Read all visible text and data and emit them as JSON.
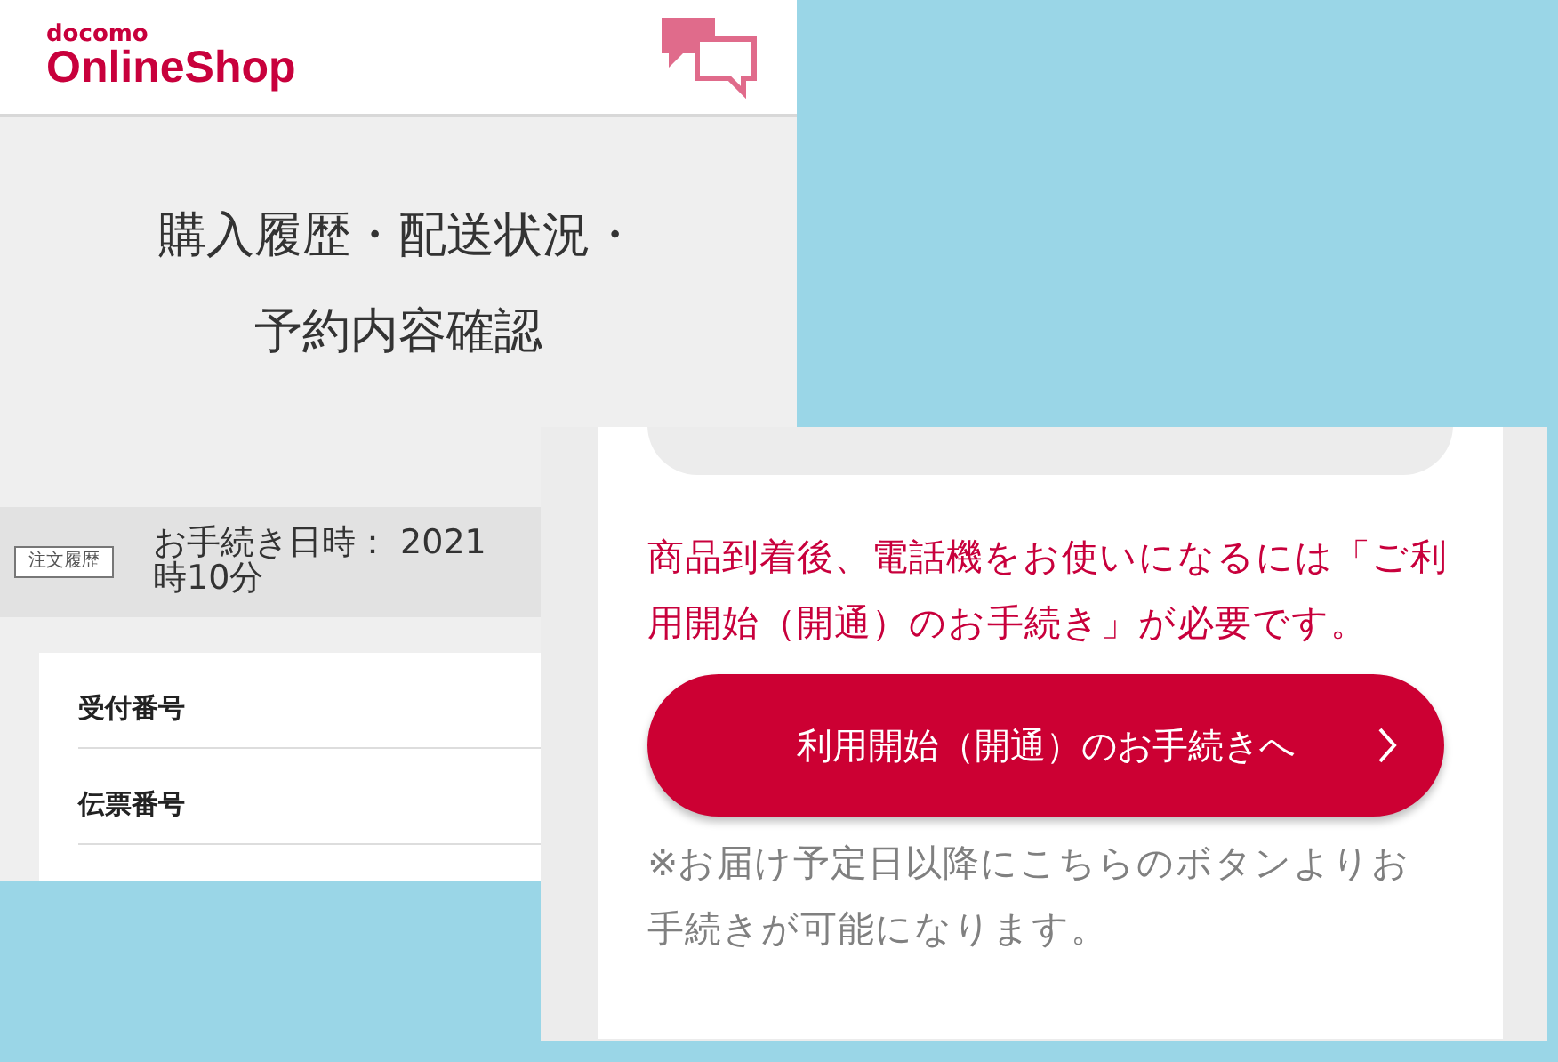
{
  "history_screen": {
    "logo": {
      "brand": "docomo",
      "name": "OnlineShop"
    },
    "title_lines": [
      "購入履歴・配送状況・",
      "予約内容確認"
    ],
    "order": {
      "badge": "注文履歴",
      "date_label": "お手続き日時： 2021",
      "date_cont": "時10分"
    },
    "rows": [
      {
        "label": "受付番号"
      },
      {
        "label": "伝票番号"
      }
    ]
  },
  "activation_screen": {
    "notice": "商品到着後、電話機をお使いになるには「ご利用開始（開通）のお手続き」が必要です。",
    "button": "利用開始（開通）のお手続きへ",
    "note": "※お届け予定日以降にこちらのボタンよりお手続きが可能になります。"
  }
}
